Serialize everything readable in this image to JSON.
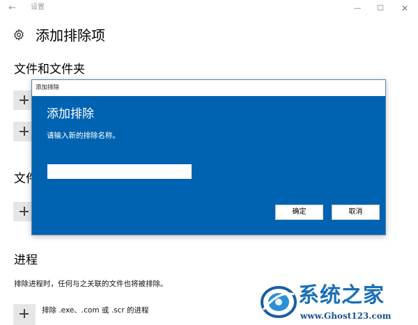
{
  "window": {
    "app_title": "设置",
    "back_icon": "arrow-left-icon",
    "minimize_icon": "minimize-icon",
    "maximize_icon": "maximize-icon",
    "close_icon": "close-icon"
  },
  "page": {
    "title": "添加排除项",
    "title_icon": "gear-icon"
  },
  "sections": {
    "files_and_folders": {
      "title": "文件和文件夹"
    },
    "file_types": {
      "title": "文件"
    },
    "processes": {
      "title": "进程",
      "description": "排除进程时，任何与之关联的文件也将被排除。",
      "add_label": "排除 .exe、.com 或 .scr 的进程"
    }
  },
  "dialog": {
    "caption": "添加排除",
    "heading": "添加排除",
    "prompt": "请输入新的排除名称。",
    "input_value": "",
    "ok_label": "确定",
    "cancel_label": "取消",
    "accent_color": "#0063b1"
  },
  "watermark": {
    "name": "系统之家",
    "url": "www.Ghost123.com"
  }
}
